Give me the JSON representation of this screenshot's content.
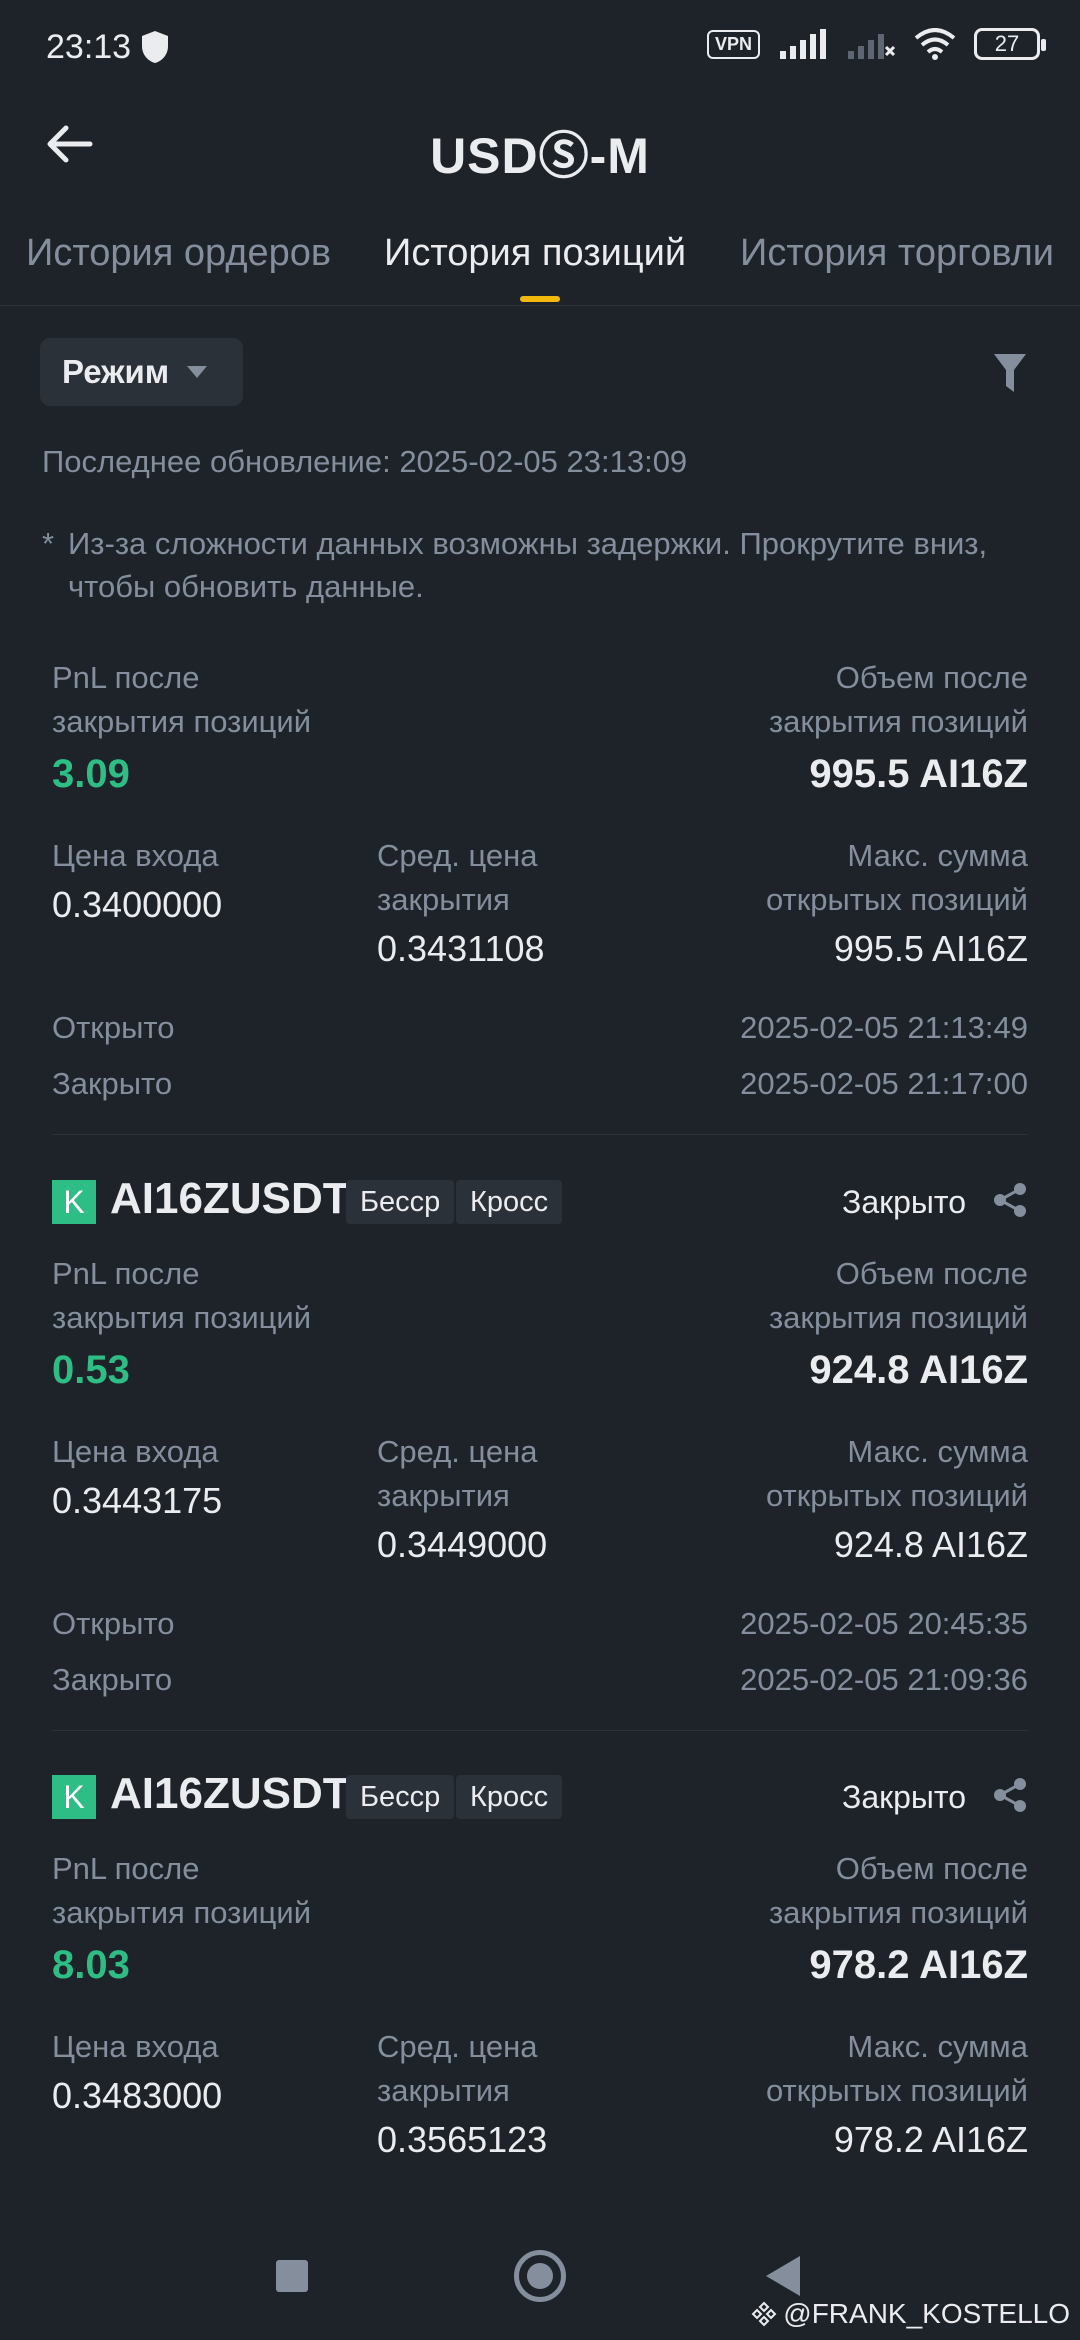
{
  "status_bar": {
    "time": "23:13",
    "vpn": "VPN",
    "battery": "27"
  },
  "header": {
    "title": "USDⓈ-M"
  },
  "tabs": [
    {
      "label": "История ордеров"
    },
    {
      "label": "История позиций"
    },
    {
      "label": "История торговли"
    }
  ],
  "filter": {
    "mode_label": "Режим"
  },
  "last_update": "Последнее обновление: 2025-02-05 23:13:09",
  "note": {
    "star": "*",
    "text": "Из-за сложности данных возможны задержки. Прокрутите вниз, чтобы обновить данные."
  },
  "labels": {
    "pnl": [
      "PnL после",
      "закрытия позиций"
    ],
    "volume": [
      "Объем после",
      "закрытия позиций"
    ],
    "entry": "Цена входа",
    "avg_close": [
      "Сред. цена",
      "закрытия"
    ],
    "max_sum": [
      "Макс. сумма",
      "открытых позиций"
    ],
    "opened": "Открыто",
    "closed": "Закрыто"
  },
  "positions": [
    {
      "pnl": "3.09",
      "volume": "995.5 AI16Z",
      "entry": "0.3400000",
      "avg_close": "0.3431108",
      "max_sum": "995.5 AI16Z",
      "opened_at": "2025-02-05 21:13:49",
      "closed_at": "2025-02-05 21:17:00"
    },
    {
      "badge": "K",
      "symbol": "AI16ZUSDT",
      "tag1": "Бесср",
      "tag2": "Кросс",
      "status": "Закрыто",
      "pnl": "0.53",
      "volume": "924.8 AI16Z",
      "entry": "0.3443175",
      "avg_close": "0.3449000",
      "max_sum": "924.8 AI16Z",
      "opened_at": "2025-02-05 20:45:35",
      "closed_at": "2025-02-05 21:09:36"
    },
    {
      "badge": "K",
      "symbol": "AI16ZUSDT",
      "tag1": "Бесср",
      "tag2": "Кросс",
      "status": "Закрыто",
      "pnl": "8.03",
      "volume": "978.2 AI16Z",
      "entry": "0.3483000",
      "avg_close": "0.3565123",
      "max_sum": "978.2 AI16Z"
    }
  ],
  "watermark": "@FRANK_KOSTELLO"
}
